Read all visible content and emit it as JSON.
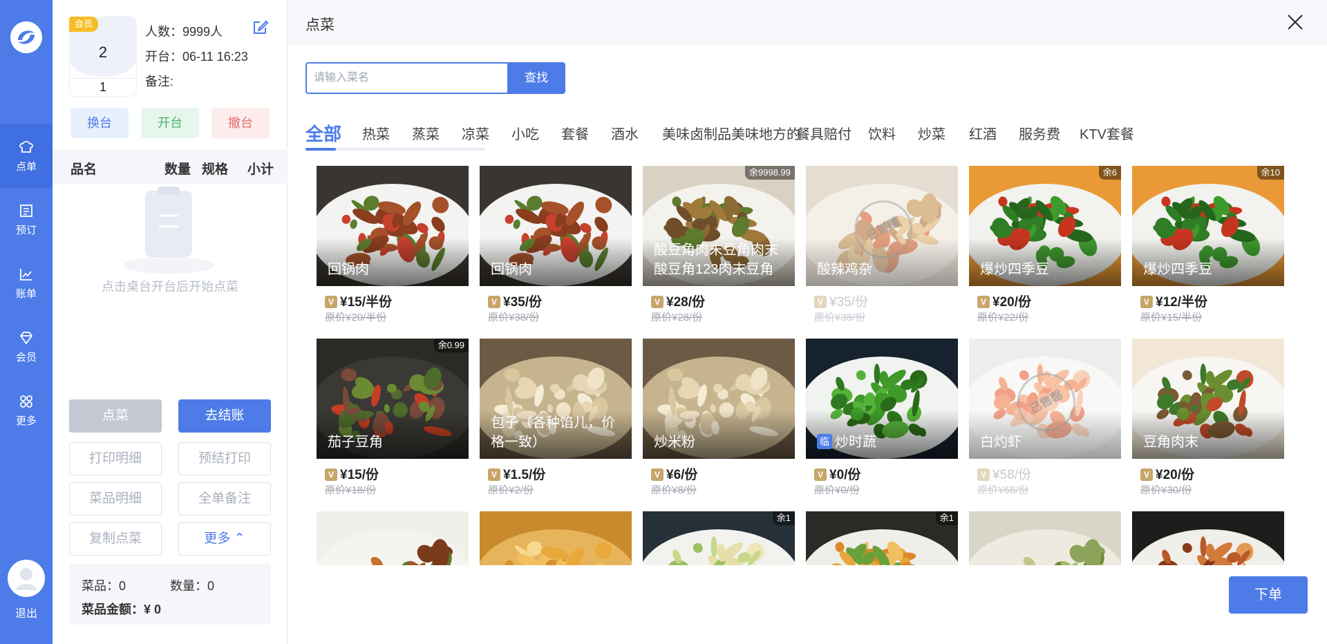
{
  "nav": {
    "items": [
      {
        "label": "点单",
        "icon": "chef-hat-icon"
      },
      {
        "label": "预订",
        "icon": "booking-icon"
      },
      {
        "label": "账单",
        "icon": "bill-chart-icon"
      },
      {
        "label": "会员",
        "icon": "diamond-icon"
      },
      {
        "label": "更多",
        "icon": "grid-icon"
      }
    ],
    "logout": "退出"
  },
  "table": {
    "badge": "会员",
    "number": "2",
    "sub": "1",
    "people": "人数：9999人",
    "open_time": "开台：06-11 16:23",
    "remark": "备注:"
  },
  "ops": {
    "change": "换台",
    "open": "开台",
    "cancel": "撤台"
  },
  "list_head": {
    "name": "品名",
    "qty": "数量",
    "spec": "规格",
    "subtotal": "小计"
  },
  "empty_text": "点击桌台开台后开始点菜",
  "actions": {
    "order": "点菜",
    "checkout": "去结账",
    "print_detail": "打印明细",
    "pre_print": "预结打印",
    "dish_detail": "菜品明细",
    "whole_remark": "全单备注",
    "copy_order": "复制点菜",
    "more": "更多 ⌃"
  },
  "summary": {
    "dishes": "菜品：0",
    "qty": "数量：0",
    "amount_label": "菜品金额：",
    "amount": "¥ 0"
  },
  "main": {
    "title": "点菜",
    "search_placeholder": "请输入菜名",
    "search_button": "查找",
    "tabs": [
      "全部",
      "热菜",
      "蒸菜",
      "凉菜",
      "小吃",
      "套餐",
      "酒水",
      "美味卤制品美味地方的",
      "餐具赔付",
      "饮料",
      "炒菜",
      "红酒",
      "服务费",
      "KTV套餐"
    ],
    "submit": "下单"
  },
  "dishes": [
    {
      "name": "回锅肉",
      "price": "¥15/半份",
      "orig": "原价¥20/半份",
      "stock": "",
      "img": "pork"
    },
    {
      "name": "回锅肉",
      "price": "¥35/份",
      "orig": "原价¥38/份",
      "stock": "",
      "img": "pork"
    },
    {
      "name": "酸豆角肉末豆角肉末酸豆角123肉末豆角肉…",
      "price": "¥28/份",
      "orig": "原价¥28/份",
      "stock": "余9998.99",
      "img": "mince"
    },
    {
      "name": "酸辣鸡杂",
      "price": "¥35/份",
      "orig": "原价¥38/份",
      "stock": "",
      "img": "chicken",
      "soldout": true,
      "stamp": "已售罄"
    },
    {
      "name": "爆炒四季豆",
      "price": "¥20/份",
      "orig": "原价¥22/份",
      "stock": "余6",
      "img": "beans"
    },
    {
      "name": "爆炒四季豆",
      "price": "¥12/半份",
      "orig": "原价¥15/半份",
      "stock": "余10",
      "img": "beans"
    },
    {
      "name": "茄子豆角",
      "price": "¥15/份",
      "orig": "原价¥18/份",
      "stock": "余0.99",
      "img": "eggplant"
    },
    {
      "name": "包子（各种馅儿，价格一致）",
      "price": "¥1.5/份",
      "orig": "原价¥2/份",
      "stock": "",
      "img": "dumpling"
    },
    {
      "name": "炒米粉",
      "price": "¥6/份",
      "orig": "原价¥8/份",
      "stock": "",
      "img": "dumpling"
    },
    {
      "name": "炒时蔬",
      "price": "¥0/份",
      "orig": "原价¥0/份",
      "stock": "",
      "img": "greens",
      "tag": "临"
    },
    {
      "name": "白灼虾",
      "price": "¥58/份",
      "orig": "原价¥68/份",
      "stock": "",
      "img": "shrimp",
      "soldout": true,
      "stamp": "已售罄"
    },
    {
      "name": "豆角肉末",
      "price": "¥20/份",
      "orig": "原价¥30/份",
      "stock": "",
      "img": "mince2"
    },
    {
      "name": "",
      "price": "",
      "orig": "",
      "stock": "",
      "img": "braised"
    },
    {
      "name": "",
      "price": "",
      "orig": "",
      "stock": "",
      "img": "soup"
    },
    {
      "name": "",
      "price": "",
      "orig": "",
      "stock": "余1",
      "img": "noodle"
    },
    {
      "name": "",
      "price": "",
      "orig": "",
      "stock": "余1",
      "img": "fried"
    },
    {
      "name": "",
      "price": "",
      "orig": "",
      "stock": "",
      "img": "pancake"
    },
    {
      "name": "",
      "price": "",
      "orig": "",
      "stock": "",
      "img": "peanut"
    }
  ],
  "colors": {
    "accent": "#4d7ce8",
    "vip": "#f6bd25",
    "green": "#4cb26e",
    "red": "#e46c6c"
  }
}
